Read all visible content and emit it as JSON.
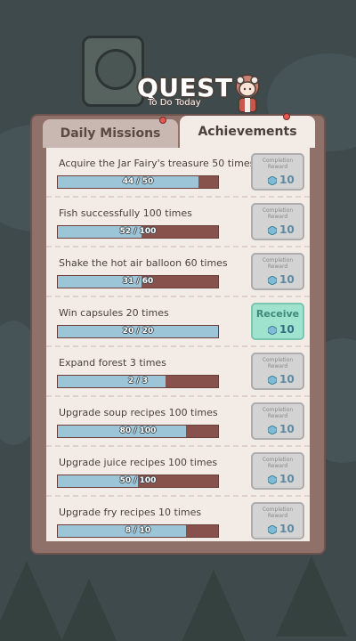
{
  "header": {
    "title": "QUEST",
    "subtitle": "To Do Today"
  },
  "tabs": [
    {
      "label": "Daily Missions",
      "active": false,
      "has_notification": true
    },
    {
      "label": "Achievements",
      "active": true,
      "has_notification": true
    }
  ],
  "reward_label": "Completion Reward",
  "receive_label": "Receive",
  "achievements": [
    {
      "title": "Acquire the Jar Fairy's treasure 50 times",
      "progress_text": "44 / 50",
      "progress": 0.88,
      "reward": "10",
      "claimable": false
    },
    {
      "title": "Fish successfully 100 times",
      "progress_text": "52 / 100",
      "progress": 0.52,
      "reward": "10",
      "claimable": false
    },
    {
      "title": "Shake the hot air balloon 60 times",
      "progress_text": "31 / 60",
      "progress": 0.52,
      "reward": "10",
      "claimable": false
    },
    {
      "title": "Win capsules 20 times",
      "progress_text": "20 / 20",
      "progress": 1.0,
      "reward": "10",
      "claimable": true
    },
    {
      "title": "Expand forest 3 times",
      "progress_text": "2 / 3",
      "progress": 0.67,
      "reward": "10",
      "claimable": false
    },
    {
      "title": "Upgrade soup recipes 100 times",
      "progress_text": "80 / 100",
      "progress": 0.8,
      "reward": "10",
      "claimable": false
    },
    {
      "title": "Upgrade juice recipes 100 times",
      "progress_text": "50 / 100",
      "progress": 0.5,
      "reward": "10",
      "claimable": false
    },
    {
      "title": "Upgrade fry recipes 10 times",
      "progress_text": "8 / 10",
      "progress": 0.8,
      "reward": "10",
      "claimable": false
    }
  ],
  "colors": {
    "progress_fill": "#9cc5d7",
    "progress_track": "#86524b",
    "claim_button": "#9fe3cf",
    "notification_dot": "#e35a55"
  }
}
